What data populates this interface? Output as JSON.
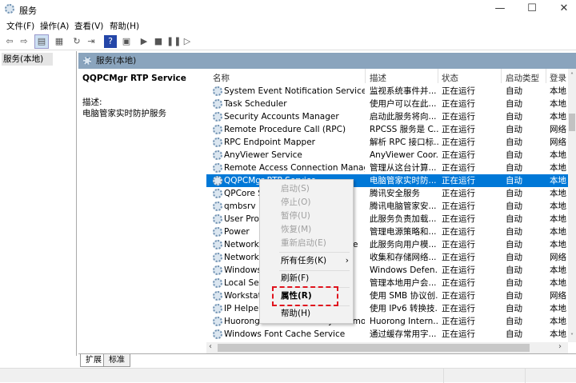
{
  "window": {
    "title": "服务",
    "minimize": "—",
    "maximize": "☐",
    "close": "✕"
  },
  "menu": [
    "文件(F)",
    "操作(A)",
    "查看(V)",
    "帮助(H)"
  ],
  "toolbar": {
    "icons": [
      "back-icon",
      "forward-icon",
      "show-tree-icon",
      "properties-icon",
      "refresh-icon",
      "export-icon",
      "help-icon",
      "console-icon",
      "start-icon",
      "stop-icon",
      "pause-icon",
      "resume-icon"
    ],
    "glyphs": [
      "⇦",
      "⇨",
      "▤",
      "▦",
      "↻",
      "⇥",
      "?",
      "▣",
      "▶",
      "■",
      "❚❚",
      "▷"
    ]
  },
  "tree": {
    "root": "服务(本地)"
  },
  "panel": {
    "header": "服务(本地)",
    "service_name": "QQPCMgr RTP Service",
    "desc_label": "描述:",
    "desc_text": "电脑管家实时防护服务"
  },
  "columns": [
    "名称",
    "描述",
    "状态",
    "启动类型",
    "登录"
  ],
  "rows": [
    [
      "System Event Notification Service",
      "监视系统事件并...",
      "正在运行",
      "自动",
      "本地"
    ],
    [
      "Task Scheduler",
      "使用户可以在此...",
      "正在运行",
      "自动",
      "本地"
    ],
    [
      "Security Accounts Manager",
      "启动此服务将向...",
      "正在运行",
      "自动",
      "本地"
    ],
    [
      "Remote Procedure Call (RPC)",
      "RPCSS 服务是 C...",
      "正在运行",
      "自动",
      "网络"
    ],
    [
      "RPC Endpoint Mapper",
      "解析 RPC 接口标...",
      "正在运行",
      "自动",
      "网络"
    ],
    [
      "AnyViewer Service",
      "AnyViewer Coor...",
      "正在运行",
      "自动",
      "本地"
    ],
    [
      "Remote Access Connection Manager",
      "管理从这台计算...",
      "正在运行",
      "自动",
      "本地"
    ],
    [
      "QQPCMgr RTP Service",
      "电脑管家实时防...",
      "正在运行",
      "自动",
      "本地"
    ],
    [
      "QPCore Service",
      "腾讯安全服务",
      "正在运行",
      "自动",
      "本地"
    ],
    [
      "qmbsrv",
      "腾讯电脑管家安...",
      "正在运行",
      "自动",
      "本地"
    ],
    [
      "User Profile Service",
      "此服务负责加载...",
      "正在运行",
      "自动",
      "本地"
    ],
    [
      "Power",
      "管理电源策略和...",
      "正在运行",
      "自动",
      "本地"
    ],
    [
      "Network Store Interface Service",
      "此服务向用户模...",
      "正在运行",
      "自动",
      "本地"
    ],
    [
      "Network List Service",
      "收集和存储网络...",
      "正在运行",
      "自动",
      "网络"
    ],
    [
      "Windows Defender Firewall",
      "Windows Defen...",
      "正在运行",
      "自动",
      "本地"
    ],
    [
      "Local Session Manager",
      "管理本地用户会...",
      "正在运行",
      "自动",
      "本地"
    ],
    [
      "Workstation",
      "使用 SMB 协议创...",
      "正在运行",
      "自动",
      "网络"
    ],
    [
      "IP Helper",
      "使用 IPv6 转换技...",
      "正在运行",
      "自动",
      "本地"
    ],
    [
      "Huorong Internet Security Daemon",
      "Huorong Intern...",
      "正在运行",
      "自动",
      "本地"
    ],
    [
      "Windows Font Cache Service",
      "通过缓存常用字...",
      "正在运行",
      "自动",
      "本地"
    ]
  ],
  "selected_row": 7,
  "context_menu": {
    "start": "启动(S)",
    "stop": "停止(O)",
    "pause": "暂停(U)",
    "resume": "恢复(M)",
    "restart": "重新启动(E)",
    "all_tasks": "所有任务(K)",
    "all_tasks_arrow": "›",
    "refresh": "刷新(F)",
    "properties": "属性(R)",
    "help": "帮助(H)"
  },
  "tabs": [
    "扩展",
    "标准"
  ],
  "colors": {
    "selection": "#0078d7",
    "highlight": "#e0141e",
    "header": "#8aa4bd"
  }
}
